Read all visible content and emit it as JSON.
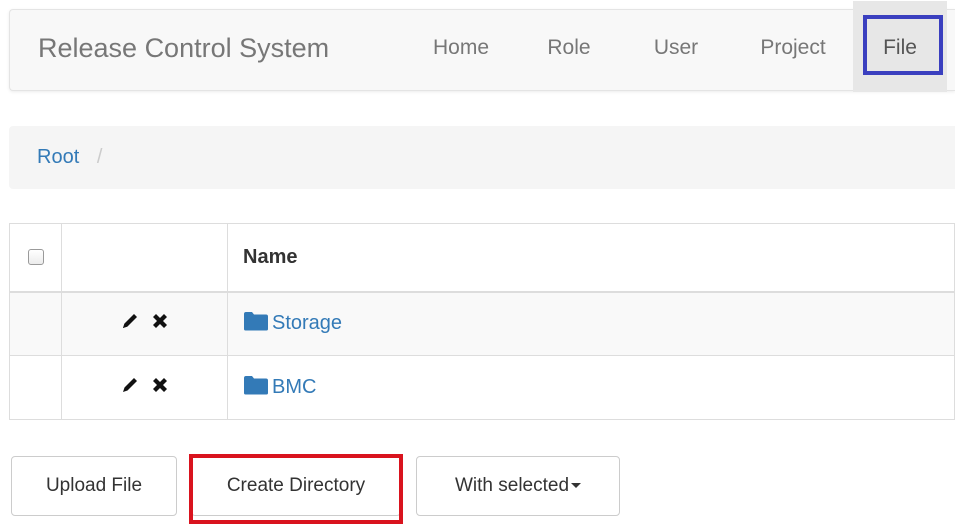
{
  "navbar": {
    "brand": "Release Control System",
    "items": [
      {
        "label": "Home"
      },
      {
        "label": "Role"
      },
      {
        "label": "User"
      },
      {
        "label": "Project"
      },
      {
        "label": "File",
        "active": true
      }
    ]
  },
  "breadcrumb": {
    "root": "Root",
    "separator": "/"
  },
  "table": {
    "headers": {
      "select": "",
      "actions": "",
      "name": "Name"
    },
    "rows": [
      {
        "name": "Storage",
        "icon": "folder-icon",
        "actions": [
          "pencil-icon",
          "remove-icon"
        ]
      },
      {
        "name": "BMC",
        "icon": "folder-icon",
        "actions": [
          "pencil-icon",
          "remove-icon"
        ]
      }
    ]
  },
  "buttons": {
    "upload": "Upload File",
    "create": "Create Directory",
    "with_selected": "With selected"
  },
  "colors": {
    "link": "#337ab7",
    "highlight_blue": "#3a3fbf",
    "highlight_red": "#d9131e",
    "navbar_bg": "#f8f8f8",
    "active_nav_bg": "#e7e7e7"
  }
}
